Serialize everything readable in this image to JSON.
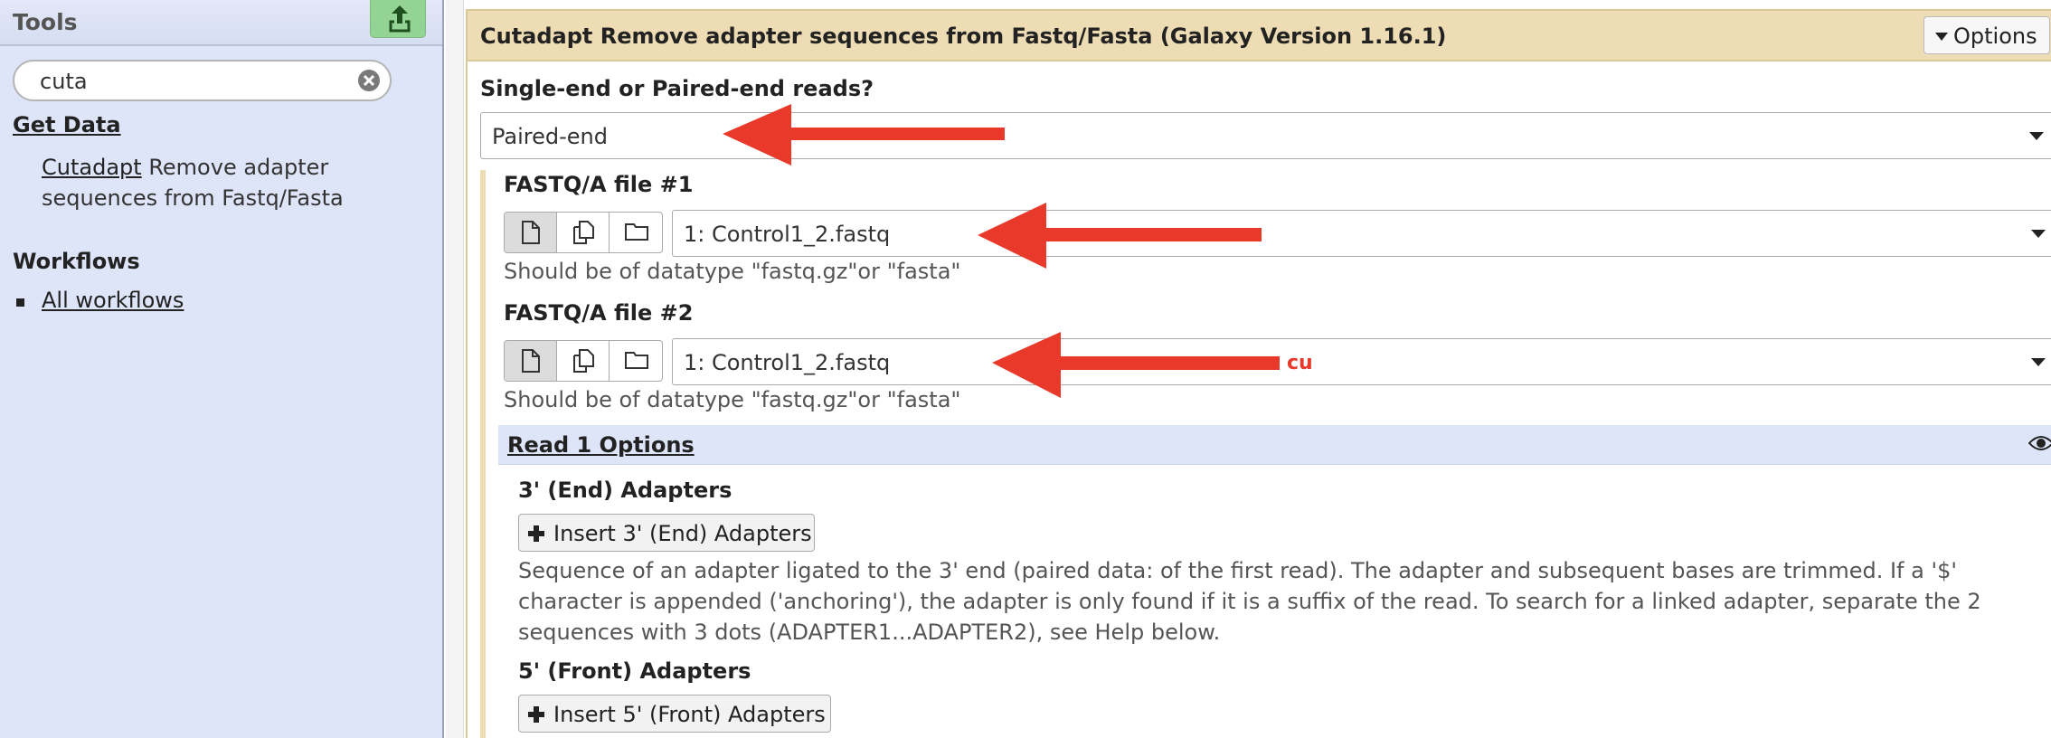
{
  "left_panel": {
    "title": "Tools",
    "search": {
      "value": "cuta"
    },
    "get_data": "Get Data",
    "tool": {
      "name": "Cutadapt",
      "description": "Remove adapter sequences from Fastq/Fasta"
    },
    "workflows_heading": "Workflows",
    "workflows_link": "All workflows"
  },
  "form": {
    "title": "Cutadapt Remove adapter sequences from Fastq/Fasta (Galaxy Version 1.16.1)",
    "options_label": "Options",
    "read_type": {
      "label": "Single-end or Paired-end reads?",
      "value": "Paired-end"
    },
    "file1": {
      "label": "FASTQ/A file #1",
      "value": "1: Control1_2.fastq",
      "help": "Should be of datatype \"fastq.gz\"or \"fasta\""
    },
    "file2": {
      "label": "FASTQ/A file #2",
      "value": "1: Control1_2.fastq",
      "help": "Should be of datatype \"fastq.gz\"or \"fasta\""
    },
    "read1_section": "Read 1 Options",
    "end_adapters": {
      "label": "3' (End) Adapters",
      "button": "Insert 3' (End) Adapters"
    },
    "end_adapters_help": "Sequence of an adapter ligated to the 3' end (paired data: of the first read). The adapter and subsequent bases are trimmed. If a '$' character is appended ('anchoring'), the adapter is only found if it is a suffix of the read. To search for a linked adapter, separate the 2 sequences with 3 dots (ADAPTER1...ADAPTER2), see Help below.",
    "front_adapters": {
      "label": "5' (Front) Adapters",
      "button": "Insert 5' (Front) Adapters"
    }
  },
  "annotation_text": "cu",
  "colors": {
    "arrow": "#e8392b",
    "form_header": "#eddcb4",
    "tool_panel": "#dfe5f9",
    "upload": "#93d393"
  }
}
